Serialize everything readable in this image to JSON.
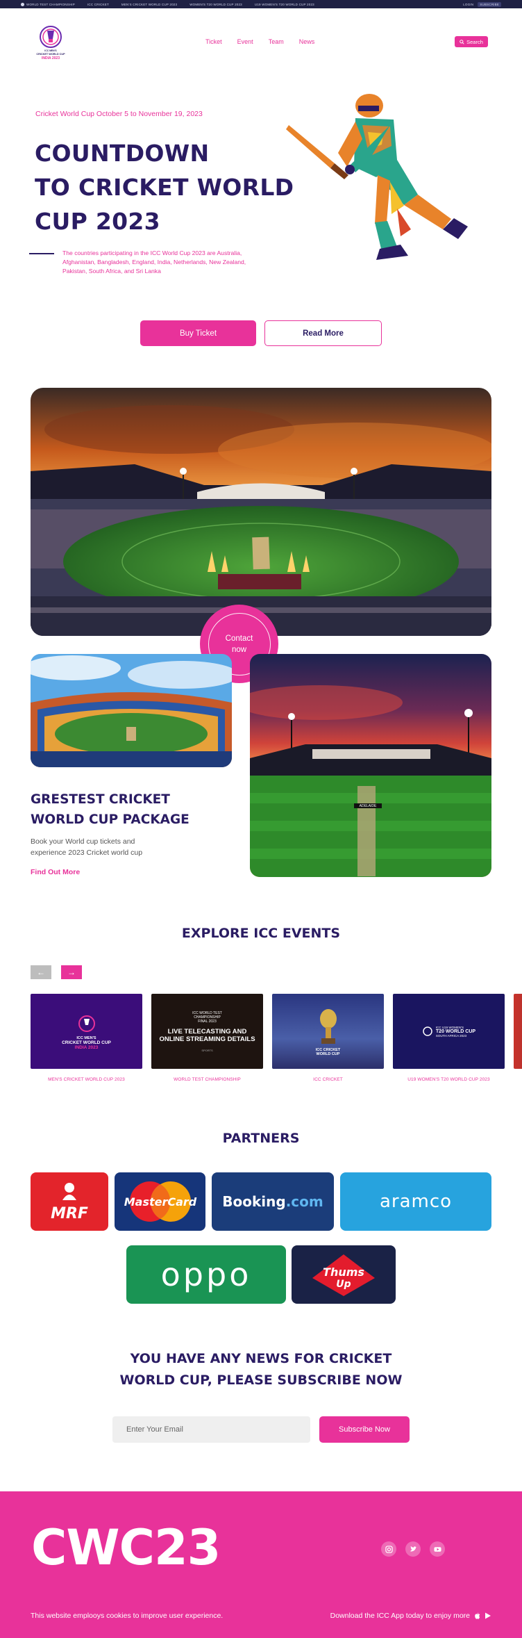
{
  "topbar": {
    "items": [
      "WORLD TEST CHAMPIONSHIP",
      "ICC CRICKET",
      "MEN'S CRICKET WORLD CUP 2023",
      "WOMEN'S T20 WORLD CUP 2023",
      "U19 WOMEN'S T20 WORLD CUP 2023"
    ],
    "login": "LOGIN",
    "subscribe": "SUBSCRIBE"
  },
  "nav": {
    "items": [
      "Ticket",
      "Event",
      "Team",
      "News"
    ],
    "search": "Search"
  },
  "logo": {
    "line1": "ICC MEN'S",
    "line2": "CRICKET WORLD CUP",
    "line3": "INDIA 2023"
  },
  "hero": {
    "date": "Cricket World Cup October 5 to November 19, 2023",
    "title_lines": [
      "COUNTDOWN",
      "TO CRICKET WORLD",
      "CUP 2023"
    ],
    "description": "The countries participating in the ICC World Cup 2023 are Australia, Afghanistan, Bangladesh, England, India, Netherlands, New Zealand, Pakistan, South Africa, and Sri Lanka",
    "buy_label": "Buy Ticket",
    "read_label": "Read More"
  },
  "contact": {
    "line1": "Contact",
    "line2": "now"
  },
  "package": {
    "title_lines": [
      "GRESTEST CRICKET",
      "WORLD CUP PACKAGE"
    ],
    "description": "Book your World cup tickets and experience 2023 Cricket world cup",
    "link": "Find Out More"
  },
  "stadium_sign": "ADELAIDE",
  "events": {
    "title": "EXPLORE ICC EVENTS",
    "prev_icon": "arrow-left-icon",
    "next_icon": "arrow-right-icon",
    "cards": [
      {
        "caption": "MEN'S CRICKET WORLD CUP 2023",
        "l1": "ICC MEN'S",
        "l2": "CRICKET WORLD CUP",
        "l3": "INDIA 2023"
      },
      {
        "caption": "WORLD TEST CHAMPIONSHIP",
        "l1": "ICC WORLD TEST",
        "l2": "CHAMPIONSHIP",
        "l3": "FINAL 2023",
        "big1": "LIVE TELECASTING AND",
        "big2": "ONLINE STREAMING DETAILS",
        "badge": "SPORTS"
      },
      {
        "caption": "ICC CRICKET",
        "l1": "ICC CRICKET",
        "l2": "WORLD CUP"
      },
      {
        "caption": "U19 WOMEN'S T20 WORLD CUP 2023",
        "l1": "ICC U19 WOMEN'S",
        "l2": "T20 WORLD CUP",
        "l3": "SOUTH AFRICA 2023"
      }
    ]
  },
  "partners": {
    "title": "PARTNERS",
    "logos": [
      "MRF",
      "MasterCard",
      "Booking",
      ".com",
      "aramco",
      "oppo",
      "Thums",
      "Up"
    ]
  },
  "subscribe": {
    "title_lines": [
      "YOU HAVE ANY NEWS FOR CRICKET",
      "WORLD CUP, PLEASE SUBSCRIBE NOW"
    ],
    "placeholder": "Enter Your Email",
    "button": "Subscribe Now"
  },
  "footer": {
    "brand": "CWC23",
    "social": [
      "instagram-icon",
      "twitter-icon",
      "youtube-icon"
    ],
    "cookie_text": "This website emplooys cookies to improve user experience.",
    "app_text": "Download the ICC App today to enjoy more"
  },
  "colors": {
    "accent": "#e8329a",
    "navy": "#2a1c63",
    "topbar": "#1f2144"
  }
}
